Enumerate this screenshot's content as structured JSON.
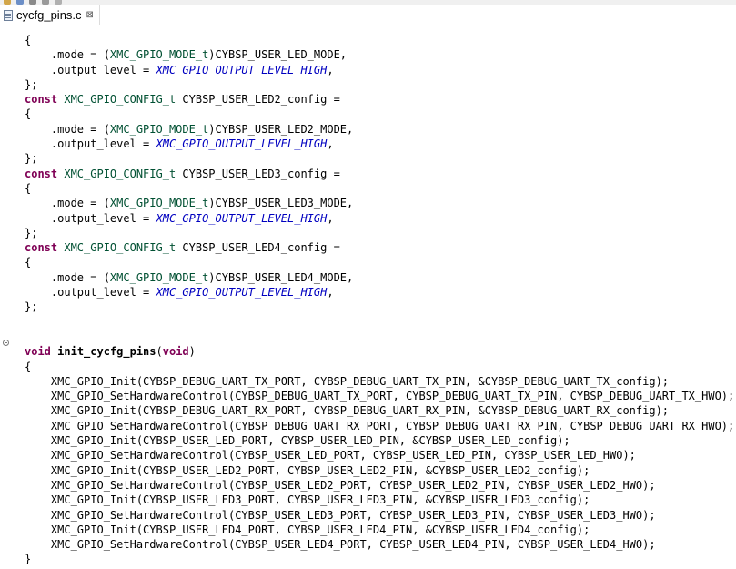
{
  "editor": {
    "tab": {
      "title": "cycfg_pins.c",
      "close_glyph": "⊠",
      "icon": "c-source-file-icon"
    },
    "lines": [
      [
        {
          "t": "{"
        }
      ],
      [
        {
          "t": "    .mode = ("
        },
        {
          "t": "XMC_GPIO_MODE_t",
          "c": "ty"
        },
        {
          "t": ")CYBSP_USER_LED_MODE,"
        }
      ],
      [
        {
          "t": "    .output_level = "
        },
        {
          "t": "XMC_GPIO_OUTPUT_LEVEL_HIGH",
          "c": "mac"
        },
        {
          "t": ","
        }
      ],
      [
        {
          "t": "};"
        }
      ],
      [
        {
          "t": "const",
          "c": "kw"
        },
        {
          "t": " "
        },
        {
          "t": "XMC_GPIO_CONFIG_t",
          "c": "ty"
        },
        {
          "t": " CYBSP_USER_LED2_config ="
        }
      ],
      [
        {
          "t": "{"
        }
      ],
      [
        {
          "t": "    .mode = ("
        },
        {
          "t": "XMC_GPIO_MODE_t",
          "c": "ty"
        },
        {
          "t": ")CYBSP_USER_LED2_MODE,"
        }
      ],
      [
        {
          "t": "    .output_level = "
        },
        {
          "t": "XMC_GPIO_OUTPUT_LEVEL_HIGH",
          "c": "mac"
        },
        {
          "t": ","
        }
      ],
      [
        {
          "t": "};"
        }
      ],
      [
        {
          "t": "const",
          "c": "kw"
        },
        {
          "t": " "
        },
        {
          "t": "XMC_GPIO_CONFIG_t",
          "c": "ty"
        },
        {
          "t": " CYBSP_USER_LED3_config ="
        }
      ],
      [
        {
          "t": "{"
        }
      ],
      [
        {
          "t": "    .mode = ("
        },
        {
          "t": "XMC_GPIO_MODE_t",
          "c": "ty"
        },
        {
          "t": ")CYBSP_USER_LED3_MODE,"
        }
      ],
      [
        {
          "t": "    .output_level = "
        },
        {
          "t": "XMC_GPIO_OUTPUT_LEVEL_HIGH",
          "c": "mac"
        },
        {
          "t": ","
        }
      ],
      [
        {
          "t": "};"
        }
      ],
      [
        {
          "t": "const",
          "c": "kw"
        },
        {
          "t": " "
        },
        {
          "t": "XMC_GPIO_CONFIG_t",
          "c": "ty"
        },
        {
          "t": " CYBSP_USER_LED4_config ="
        }
      ],
      [
        {
          "t": "{"
        }
      ],
      [
        {
          "t": "    .mode = ("
        },
        {
          "t": "XMC_GPIO_MODE_t",
          "c": "ty"
        },
        {
          "t": ")CYBSP_USER_LED4_MODE,"
        }
      ],
      [
        {
          "t": "    .output_level = "
        },
        {
          "t": "XMC_GPIO_OUTPUT_LEVEL_HIGH",
          "c": "mac"
        },
        {
          "t": ","
        }
      ],
      [
        {
          "t": "};"
        }
      ],
      [],
      [],
      [
        {
          "t": "void",
          "c": "kw"
        },
        {
          "t": " "
        },
        {
          "t": "init_cycfg_pins",
          "c": "fn"
        },
        {
          "t": "("
        },
        {
          "t": "void",
          "c": "kw"
        },
        {
          "t": ")"
        }
      ],
      [
        {
          "t": "{"
        }
      ],
      [
        {
          "t": "    XMC_GPIO_Init(CYBSP_DEBUG_UART_TX_PORT, CYBSP_DEBUG_UART_TX_PIN, &CYBSP_DEBUG_UART_TX_config);"
        }
      ],
      [
        {
          "t": "    XMC_GPIO_SetHardwareControl(CYBSP_DEBUG_UART_TX_PORT, CYBSP_DEBUG_UART_TX_PIN, CYBSP_DEBUG_UART_TX_HWO);"
        }
      ],
      [
        {
          "t": "    XMC_GPIO_Init(CYBSP_DEBUG_UART_RX_PORT, CYBSP_DEBUG_UART_RX_PIN, &CYBSP_DEBUG_UART_RX_config);"
        }
      ],
      [
        {
          "t": "    XMC_GPIO_SetHardwareControl(CYBSP_DEBUG_UART_RX_PORT, CYBSP_DEBUG_UART_RX_PIN, CYBSP_DEBUG_UART_RX_HWO);"
        }
      ],
      [
        {
          "t": "    XMC_GPIO_Init(CYBSP_USER_LED_PORT, CYBSP_USER_LED_PIN, &CYBSP_USER_LED_config);"
        }
      ],
      [
        {
          "t": "    XMC_GPIO_SetHardwareControl(CYBSP_USER_LED_PORT, CYBSP_USER_LED_PIN, CYBSP_USER_LED_HWO);"
        }
      ],
      [
        {
          "t": "    XMC_GPIO_Init(CYBSP_USER_LED2_PORT, CYBSP_USER_LED2_PIN, &CYBSP_USER_LED2_config);"
        }
      ],
      [
        {
          "t": "    XMC_GPIO_SetHardwareControl(CYBSP_USER_LED2_PORT, CYBSP_USER_LED2_PIN, CYBSP_USER_LED2_HWO);"
        }
      ],
      [
        {
          "t": "    XMC_GPIO_Init(CYBSP_USER_LED3_PORT, CYBSP_USER_LED3_PIN, &CYBSP_USER_LED3_config);"
        }
      ],
      [
        {
          "t": "    XMC_GPIO_SetHardwareControl(CYBSP_USER_LED3_PORT, CYBSP_USER_LED3_PIN, CYBSP_USER_LED3_HWO);"
        }
      ],
      [
        {
          "t": "    XMC_GPIO_Init(CYBSP_USER_LED4_PORT, CYBSP_USER_LED4_PIN, &CYBSP_USER_LED4_config);"
        }
      ],
      [
        {
          "t": "    XMC_GPIO_SetHardwareControl(CYBSP_USER_LED4_PORT, CYBSP_USER_LED4_PIN, CYBSP_USER_LED4_HWO);"
        }
      ],
      [
        {
          "t": "}"
        }
      ]
    ]
  },
  "colors": {
    "keyword": "#7f0055",
    "type": "#005032",
    "macro": "#0000c0",
    "text": "#000000"
  }
}
